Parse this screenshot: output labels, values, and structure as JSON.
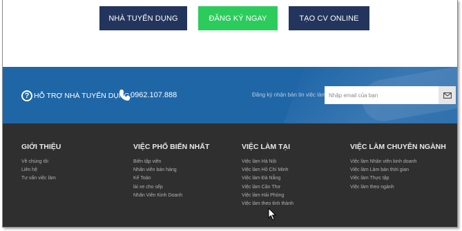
{
  "buttons": {
    "employer": "NHÀ TUYỂN DỤNG",
    "register": "ĐĂNG KÝ NGAY",
    "create_cv": "TẠO CV ONLINE"
  },
  "support": {
    "help_label": "HỖ TRỢ NHÀ TUYỂN DỤNG:",
    "phone": "0962.107.888",
    "newsletter_label": "Đăng ký nhận bản tin việc làm",
    "email_placeholder": "Nhập email của bạn"
  },
  "footer": {
    "columns": [
      {
        "title": "GIỚI THIỆU",
        "links": [
          "Về chúng tôi",
          "Liên hệ",
          "Tư vấn việc làm"
        ]
      },
      {
        "title": "VIỆC PHỔ BIẾN NHẤT",
        "links": [
          "Biên tập viên",
          "Nhân viên bán hàng",
          "Kế Toán",
          "lái xe cho sếp",
          "Nhân Viên Kinh Doanh"
        ]
      },
      {
        "title": "VIỆC LÀM TẠI",
        "links": [
          "Việc làm Hà Nội",
          "Việc làm Hồ Chí Minh",
          "Việc làm Đà Nẵng",
          "Việc làm Cần Thơ",
          "Việc làm Hải Phòng",
          "Việc làm theo tỉnh thành"
        ]
      },
      {
        "title": "VIỆC LÀM CHUYÊN NGÀNH",
        "links": [
          "Việc làm Nhân viên kinh doanh",
          "Việc làm Làm bán thời gian",
          "Việc làm Thực tập",
          "Việc làm theo ngành"
        ]
      }
    ]
  },
  "colors": {
    "navy_button": "#23355d",
    "green_button": "#2bcc5c",
    "support_bar": "#1f66a7",
    "footer_bg": "#2f2f2f"
  },
  "icons": [
    "question-circle-icon",
    "phone-icon",
    "envelope-icon",
    "mouse-cursor-icon"
  ]
}
